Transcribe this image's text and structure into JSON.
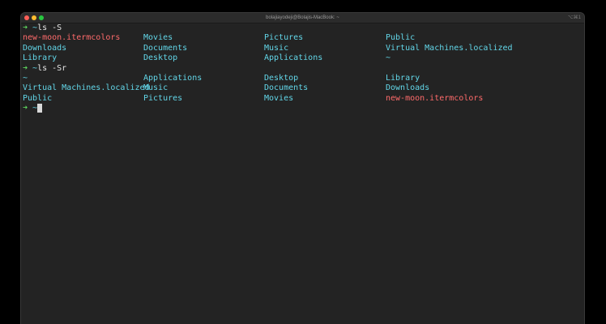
{
  "window": {
    "title": "bolajiayodeji@Bolajis-MacBook: ~",
    "shortcut": "⌥⌘1"
  },
  "terminal": {
    "prompt_arrow": "➜",
    "prompt_dir": "~",
    "command1": "ls -S",
    "output1": [
      [
        "new-moon.itermcolors",
        "Movies",
        "Pictures",
        "Public"
      ],
      [
        "Downloads",
        "Documents",
        "Music",
        "Virtual Machines.localized"
      ],
      [
        "Library",
        "Desktop",
        "Applications",
        "~"
      ]
    ],
    "command2": "ls -Sr",
    "output2": [
      [
        "~",
        "Applications",
        "Desktop",
        "Library"
      ],
      [
        "Virtual Machines.localized",
        "Music",
        "Documents",
        "Downloads"
      ],
      [
        "Public",
        "Pictures",
        "Movies",
        "new-moon.itermcolors"
      ]
    ]
  },
  "colors": {
    "directory": "#62d6e8",
    "file": "#ff6b6b",
    "prompt_arrow": "#5fd75f",
    "background": "#232323"
  }
}
